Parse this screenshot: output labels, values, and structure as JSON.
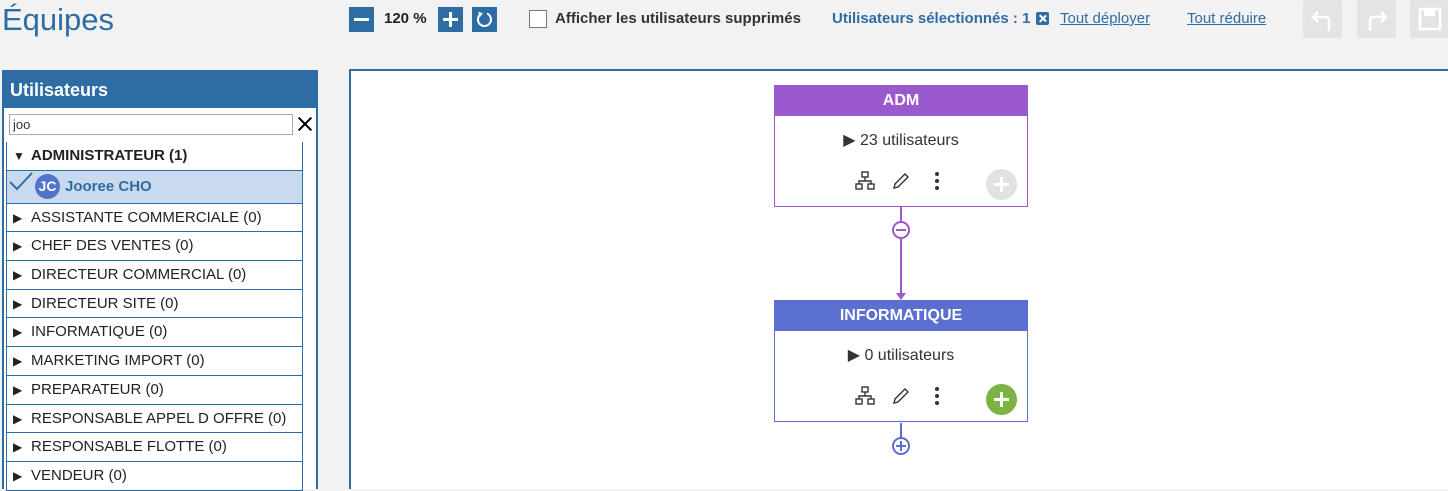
{
  "header": {
    "title": "Équipes",
    "zoom": "120 %",
    "show_deleted_label": "Afficher les utilisateurs supprimés",
    "selected_users": "Utilisateurs sélectionnés : 1",
    "expand_all": "Tout déployer",
    "collapse_all": "Tout réduire"
  },
  "sidebar": {
    "title": "Utilisateurs",
    "search_value": "joo",
    "groups": [
      {
        "label": "ADMINISTRATEUR (1)",
        "expanded": true
      },
      {
        "label": "ASSISTANTE COMMERCIALE (0)",
        "expanded": false
      },
      {
        "label": "CHEF DES VENTES (0)",
        "expanded": false
      },
      {
        "label": "DIRECTEUR COMMERCIAL (0)",
        "expanded": false
      },
      {
        "label": "DIRECTEUR SITE (0)",
        "expanded": false
      },
      {
        "label": "INFORMATIQUE (0)",
        "expanded": false
      },
      {
        "label": "MARKETING IMPORT (0)",
        "expanded": false
      },
      {
        "label": "PREPARATEUR (0)",
        "expanded": false
      },
      {
        "label": "RESPONSABLE APPEL D OFFRE (0)",
        "expanded": false
      },
      {
        "label": "RESPONSABLE FLOTTE (0)",
        "expanded": false
      },
      {
        "label": "VENDEUR (0)",
        "expanded": false
      }
    ],
    "selected_user": {
      "initials": "JC",
      "name": "Jooree CHO"
    }
  },
  "tree": {
    "nodes": [
      {
        "name": "ADM",
        "count": "▶ 23 utilisateurs",
        "color": "#9b59d0"
      },
      {
        "name": "INFORMATIQUE",
        "count": "▶ 0 utilisateurs",
        "color": "#5a6fd0"
      }
    ]
  },
  "colors": {
    "accent": "#2e6da4",
    "add_green": "#7cb342"
  }
}
